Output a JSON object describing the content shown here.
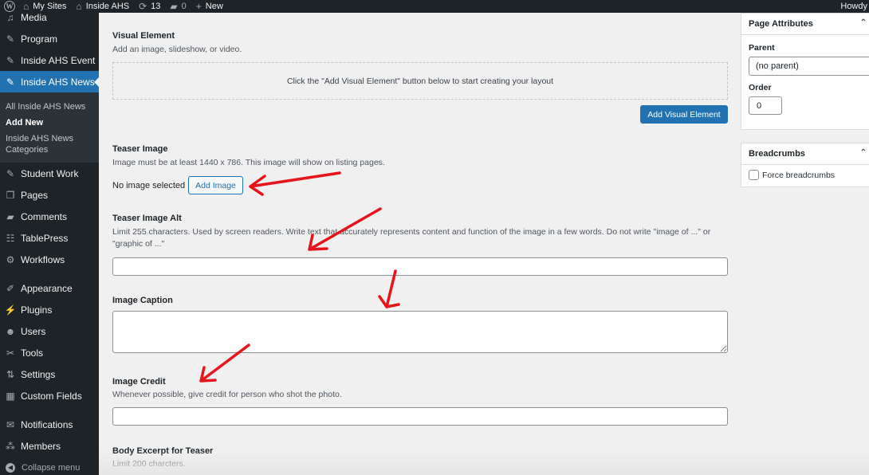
{
  "adminbar": {
    "sites_label": "My Sites",
    "site_name": "Inside AHS",
    "updates_count": "13",
    "comments_count": "0",
    "new_label": "New",
    "howdy": "Howdy"
  },
  "sidebar": {
    "items_top": [
      {
        "label": "Media",
        "icon": "media-icon",
        "glyph": "♫"
      },
      {
        "label": "Program",
        "icon": "pin-icon",
        "glyph": "✎"
      },
      {
        "label": "Inside AHS Event",
        "icon": "pin-icon",
        "glyph": "✎"
      },
      {
        "label": "Inside AHS News",
        "icon": "pin-icon",
        "glyph": "✎",
        "current": true
      }
    ],
    "submenu": [
      {
        "label": "All Inside AHS News"
      },
      {
        "label": "Add New",
        "active": true
      },
      {
        "label": "Inside AHS News Categories"
      }
    ],
    "items_mid": [
      {
        "label": "Student Work",
        "icon": "pin-icon",
        "glyph": "✎"
      },
      {
        "label": "Pages",
        "icon": "pages-icon",
        "glyph": "❐"
      },
      {
        "label": "Comments",
        "icon": "comment-icon",
        "glyph": "▰"
      },
      {
        "label": "TablePress",
        "icon": "table-icon",
        "glyph": "☷"
      },
      {
        "label": "Workflows",
        "icon": "gear-icon",
        "glyph": "⚙"
      }
    ],
    "items_admin": [
      {
        "label": "Appearance",
        "icon": "brush-icon",
        "glyph": "✐"
      },
      {
        "label": "Plugins",
        "icon": "plug-icon",
        "glyph": "⚡"
      },
      {
        "label": "Users",
        "icon": "user-icon",
        "glyph": "☻"
      },
      {
        "label": "Tools",
        "icon": "wrench-icon",
        "glyph": "✂"
      },
      {
        "label": "Settings",
        "icon": "settings-icon",
        "glyph": "⇅"
      },
      {
        "label": "Custom Fields",
        "icon": "fields-icon",
        "glyph": "▦"
      }
    ],
    "items_extra": [
      {
        "label": "Notifications",
        "icon": "envelope-icon",
        "glyph": "✉"
      },
      {
        "label": "Members",
        "icon": "members-icon",
        "glyph": "⁂"
      }
    ],
    "collapse_label": "Collapse menu"
  },
  "main": {
    "visual_element": {
      "label": "Visual Element",
      "description": "Add an image, slideshow, or video.",
      "dropzone_text": "Click the \"Add Visual Element\" button below to start creating your layout",
      "button_label": "Add Visual Element"
    },
    "teaser_image": {
      "label": "Teaser Image",
      "description": "Image must be at least 1440 x 786. This image will show on listing pages.",
      "status": "No image selected",
      "button_label": "Add Image"
    },
    "teaser_image_alt": {
      "label": "Teaser Image Alt",
      "description": "Limit 255 characters. Used by screen readers. Write text that accurately represents content and function of the image in a few words. Do not write \"image of ...\" or \"graphic of ...\"",
      "value": ""
    },
    "image_caption": {
      "label": "Image Caption",
      "value": ""
    },
    "image_credit": {
      "label": "Image Credit",
      "description": "Whenever possible, give credit for person who shot the photo.",
      "value": ""
    },
    "body_excerpt": {
      "label": "Body Excerpt for Teaser",
      "description": "Limit 200 charcters."
    }
  },
  "page_attributes": {
    "title": "Page Attributes",
    "parent_label": "Parent",
    "parent_value": "(no parent)",
    "order_label": "Order",
    "order_value": "0"
  },
  "breadcrumbs": {
    "title": "Breadcrumbs",
    "checkbox_label": "Force breadcrumbs",
    "checked": false
  },
  "annotation_color": "#e8141b"
}
